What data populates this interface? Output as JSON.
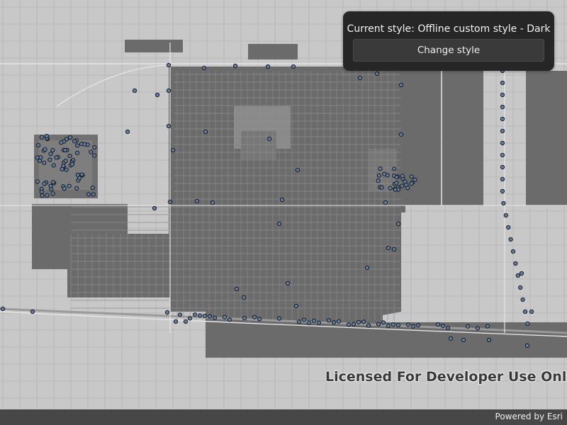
{
  "map": {
    "view": "offline-basemap",
    "basemap_style": "dark-custom",
    "feature_color": "#5d7faa",
    "water_color": "#7d7d7d"
  },
  "style_panel": {
    "current_style_label": "Current style: Offline custom style - Dark",
    "change_style_button": "Change style"
  },
  "watermark": {
    "text": "Licensed For Developer Use Only"
  },
  "attribution": {
    "powered_by": "Powered by Esri"
  },
  "colors": {
    "panel_background": "#262626",
    "button_background": "#3a3a3a",
    "urban_fill": "#6c6c6c",
    "background": "#c8c8c8"
  }
}
